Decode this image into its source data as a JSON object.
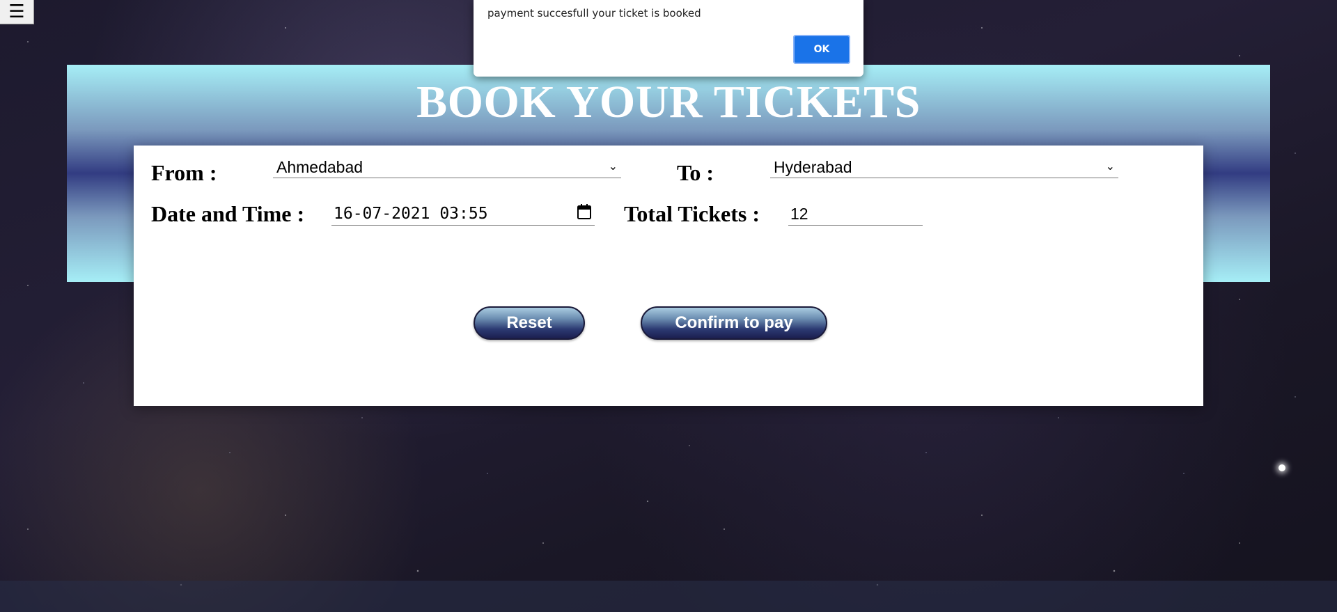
{
  "menu": {
    "icon": "hamburger-menu-icon",
    "glyph": "☰"
  },
  "alert": {
    "message": "payment succesfull your ticket is booked",
    "ok_label": "OK",
    "ok_color": "#1a73e8"
  },
  "page": {
    "title": "BOOK YOUR TICKETS"
  },
  "form": {
    "from_label": "From :",
    "from_value": "Ahmedabad",
    "to_label": "To :",
    "to_value": "Hyderabad",
    "datetime_label": "Date and Time :",
    "datetime_value": "16-07-2021 03:55",
    "tickets_label": "Total Tickets :",
    "tickets_value": "12",
    "chevron_glyph": "⌄"
  },
  "buttons": {
    "reset_label": "Reset",
    "confirm_label": "Confirm to pay"
  }
}
